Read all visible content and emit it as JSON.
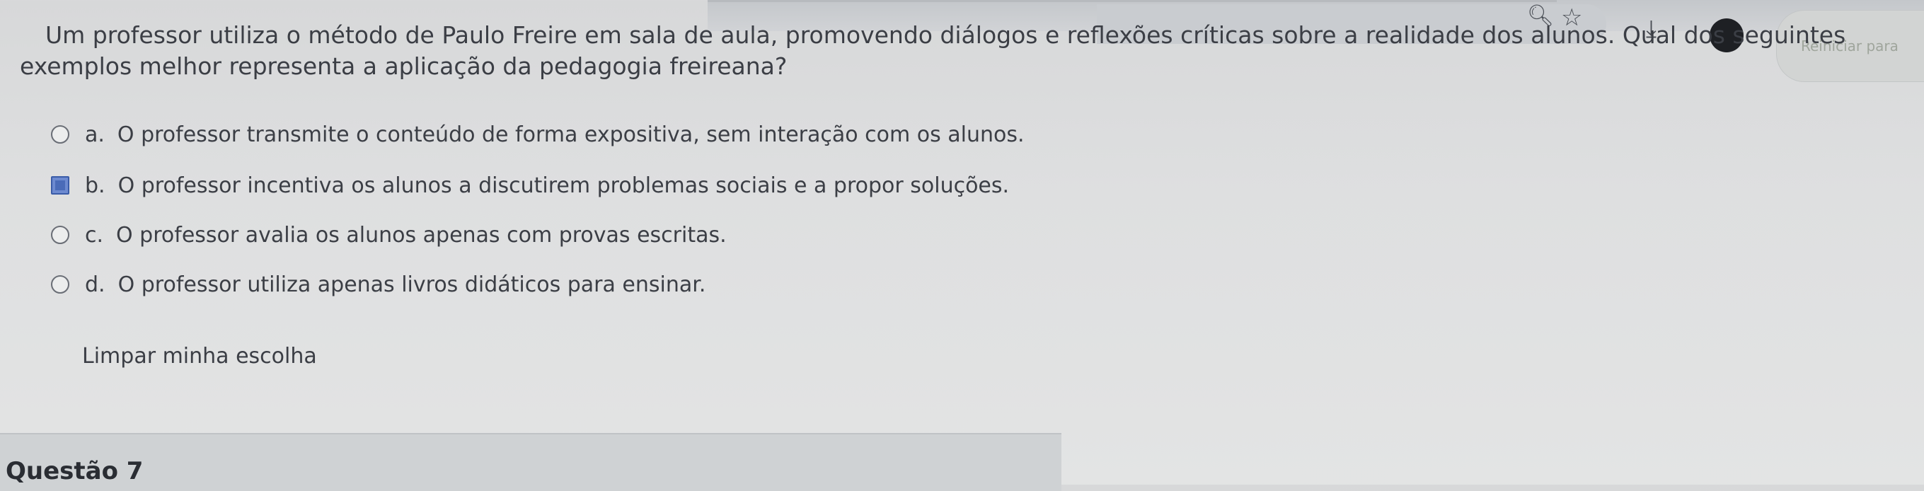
{
  "browser": {
    "icons": [
      "search-icon",
      "star-icon",
      "download-icon",
      "profile-icon"
    ],
    "restart_label": "Reiniciar para"
  },
  "question": {
    "text": "Um professor utiliza o método de Paulo Freire em sala de aula, promovendo diálogos e reflexões críticas sobre a realidade dos alunos. Qual dos seguintes exemplos melhor representa a aplicação da pedagogia freireana?",
    "options": [
      {
        "letter": "a.",
        "text": "O professor transmite o conteúdo de forma expositiva, sem interação com os alunos.",
        "selected": false
      },
      {
        "letter": "b.",
        "text": "O professor incentiva os alunos a discutirem problemas sociais e a propor soluções.",
        "selected": true
      },
      {
        "letter": "c.",
        "text": "O professor avalia os alunos apenas com provas escritas.",
        "selected": false
      },
      {
        "letter": "d.",
        "text": "O professor utiliza apenas livros didáticos para ensinar.",
        "selected": false
      }
    ],
    "clear_label": "Limpar minha escolha"
  },
  "next_question": {
    "title": "Questão 7"
  },
  "colors": {
    "background": "#dedfe0",
    "text": "#3b3e45",
    "selected_radio": "#4a6bb8"
  }
}
